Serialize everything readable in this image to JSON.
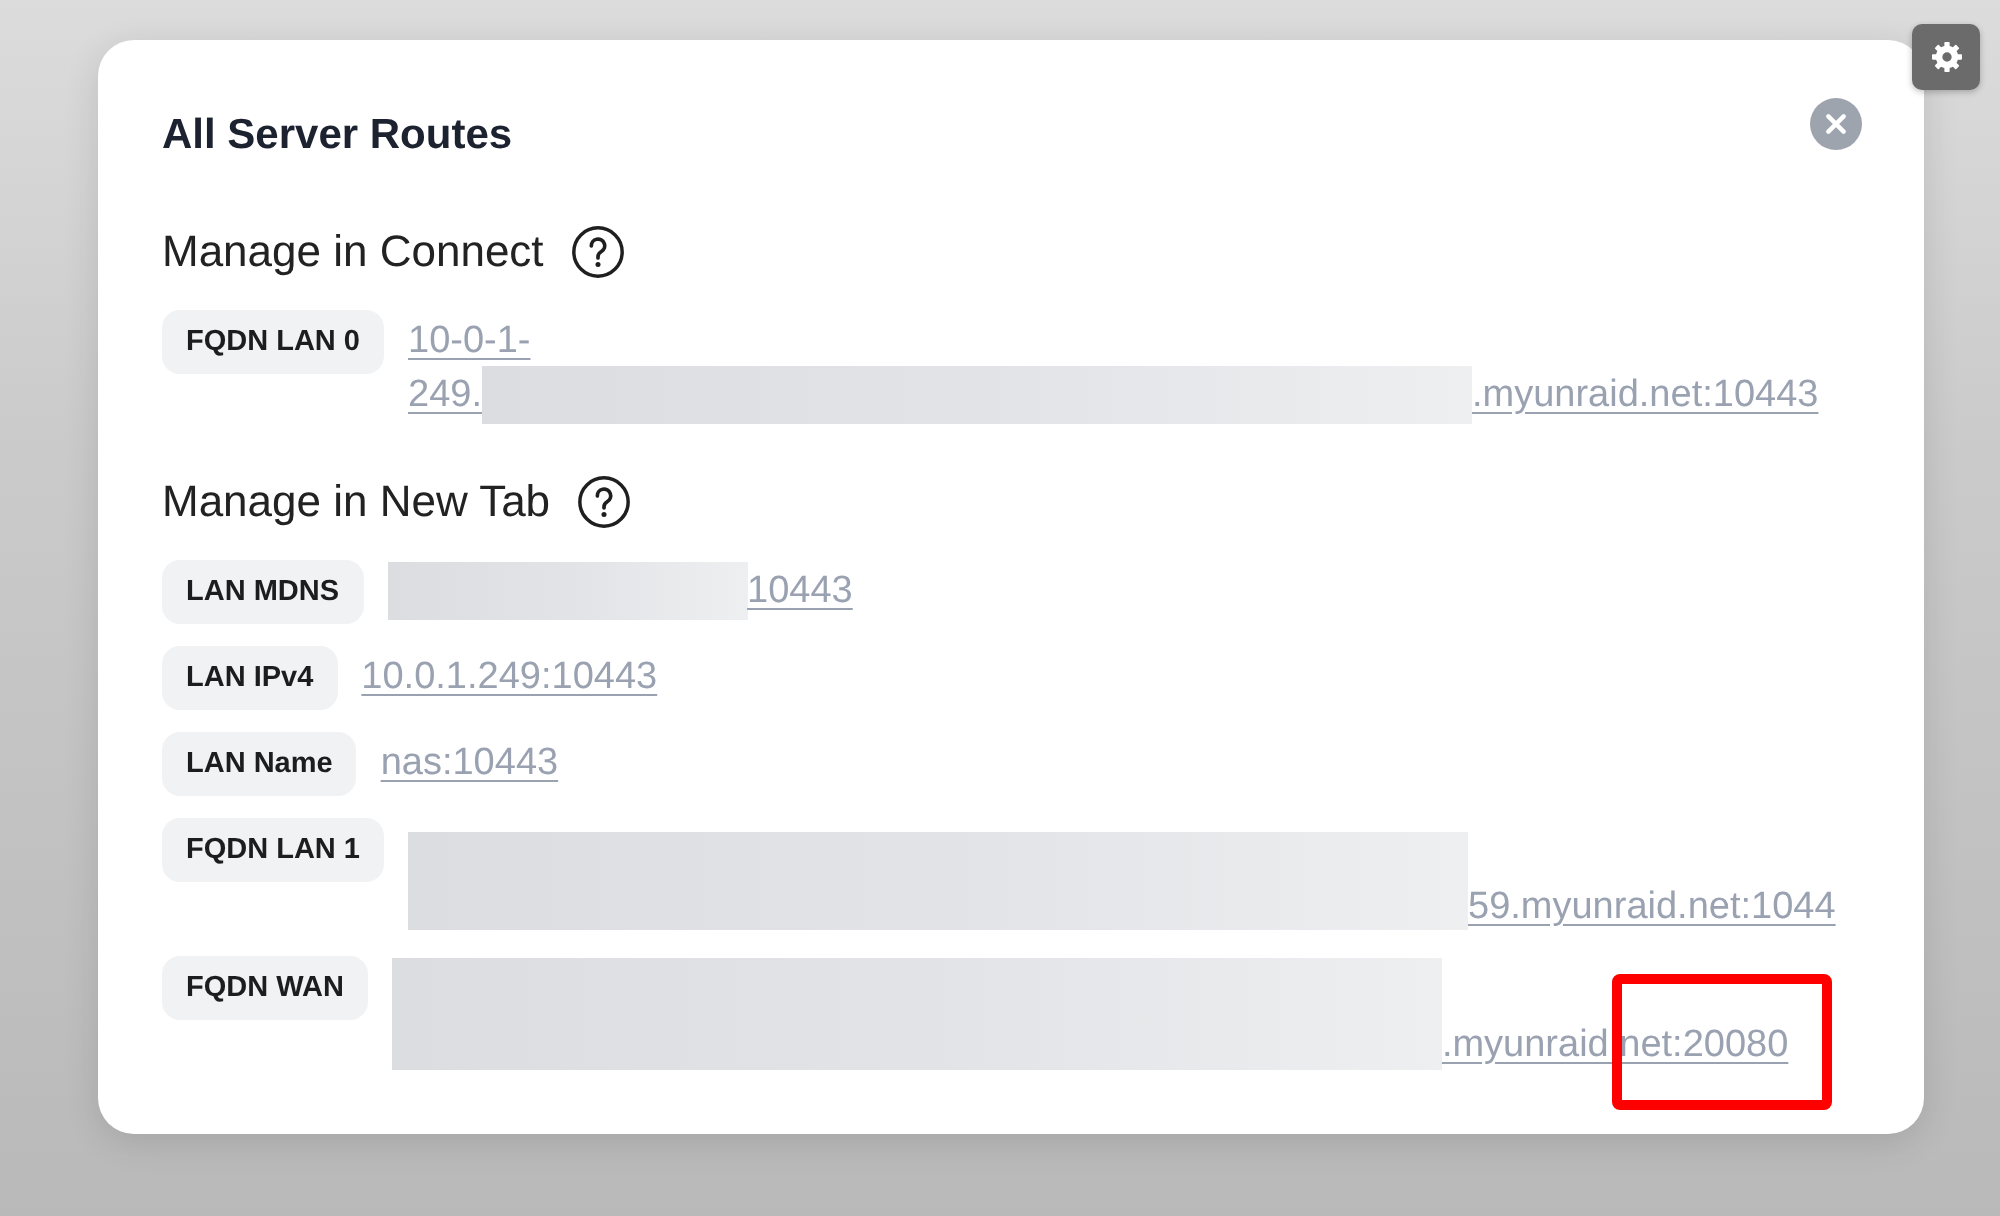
{
  "dialog": {
    "title": "All Server Routes",
    "sections": [
      {
        "heading": "Manage in Connect",
        "routes": [
          {
            "label": "FQDN LAN 0",
            "highlighted": false,
            "link": [
              {
                "kind": "text",
                "text": "10-0-1-"
              },
              {
                "kind": "text",
                "text": "249."
              },
              {
                "kind": "redacted"
              },
              {
                "kind": "text",
                "text": ".myunraid.net:10443"
              }
            ]
          }
        ]
      },
      {
        "heading": "Manage in New Tab",
        "routes": [
          {
            "label": "LAN MDNS",
            "highlighted": false,
            "link": [
              {
                "kind": "redacted"
              },
              {
                "kind": "text",
                "text": "10443"
              }
            ]
          },
          {
            "label": "LAN IPv4",
            "highlighted": false,
            "link": [
              {
                "kind": "text",
                "text": "10.0.1.249:10443"
              }
            ]
          },
          {
            "label": "LAN Name",
            "highlighted": false,
            "link": [
              {
                "kind": "text",
                "text": "nas:10443"
              }
            ]
          },
          {
            "label": "FQDN LAN 1",
            "highlighted": false,
            "link": [
              {
                "kind": "redacted"
              },
              {
                "kind": "text",
                "text": "59.myunraid.net:1044"
              }
            ]
          },
          {
            "label": "FQDN WAN",
            "highlighted": true,
            "link": [
              {
                "kind": "redacted"
              },
              {
                "kind": "text",
                "text": ".myunraid.net:20080"
              }
            ]
          }
        ]
      }
    ]
  }
}
